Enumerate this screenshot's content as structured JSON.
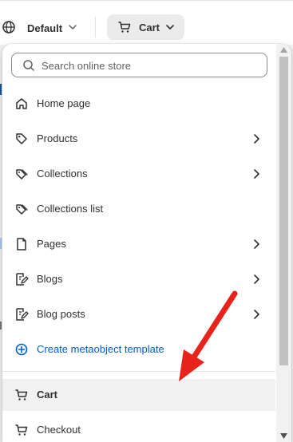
{
  "topbar": {
    "theme_selector_label": "Default",
    "template_selector_label": "Cart"
  },
  "search": {
    "placeholder": "Search online store"
  },
  "menu": {
    "items": [
      {
        "label": "Home page",
        "icon": "home-icon",
        "has_submenu": false
      },
      {
        "label": "Products",
        "icon": "tag-icon",
        "has_submenu": true
      },
      {
        "label": "Collections",
        "icon": "collection-tag-icon",
        "has_submenu": true
      },
      {
        "label": "Collections list",
        "icon": "collection-tag-icon",
        "has_submenu": false
      },
      {
        "label": "Pages",
        "icon": "page-icon",
        "has_submenu": true
      },
      {
        "label": "Blogs",
        "icon": "blog-icon",
        "has_submenu": true
      },
      {
        "label": "Blog posts",
        "icon": "blog-icon",
        "has_submenu": true
      },
      {
        "label": "Create metaobject template",
        "icon": "plus-circle-icon",
        "has_submenu": false
      }
    ],
    "pinned": [
      {
        "label": "Cart",
        "icon": "cart-icon",
        "active": true
      },
      {
        "label": "Checkout",
        "icon": "cart-icon",
        "active": false
      }
    ]
  },
  "colors": {
    "accent_link": "#005bd3",
    "annotation_arrow": "#e8231b",
    "active_row_bg": "#f1f1f1"
  }
}
